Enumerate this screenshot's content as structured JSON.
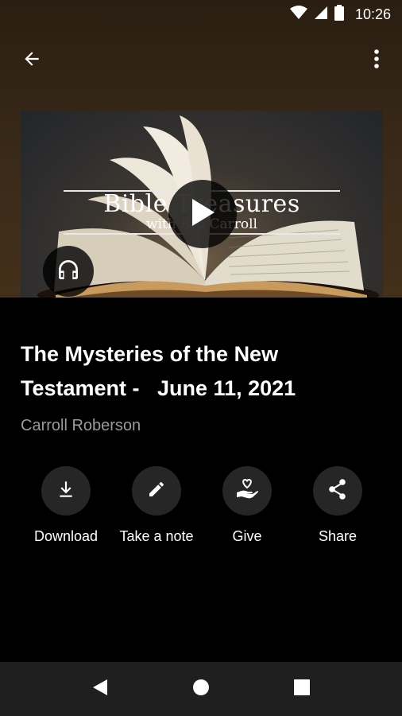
{
  "status_bar": {
    "time": "10:26"
  },
  "episode": {
    "title": "The Mysteries of the New Testament -   June 11, 2021",
    "author": "Carroll Roberson"
  },
  "artwork": {
    "title": "Bible Treasures",
    "subtitle": "with Bro Carroll"
  },
  "actions": [
    {
      "label": "Download",
      "icon": "download-icon"
    },
    {
      "label": "Take a note",
      "icon": "pencil-icon"
    },
    {
      "label": "Give",
      "icon": "heart-hand-icon"
    },
    {
      "label": "Share",
      "icon": "share-icon"
    }
  ],
  "colors": {
    "header_bg": "#3a2a18",
    "panel_bg": "#000000",
    "action_circle": "#262626",
    "author_text": "#9a9a9a",
    "nav_bar": "#1f1f1f"
  }
}
